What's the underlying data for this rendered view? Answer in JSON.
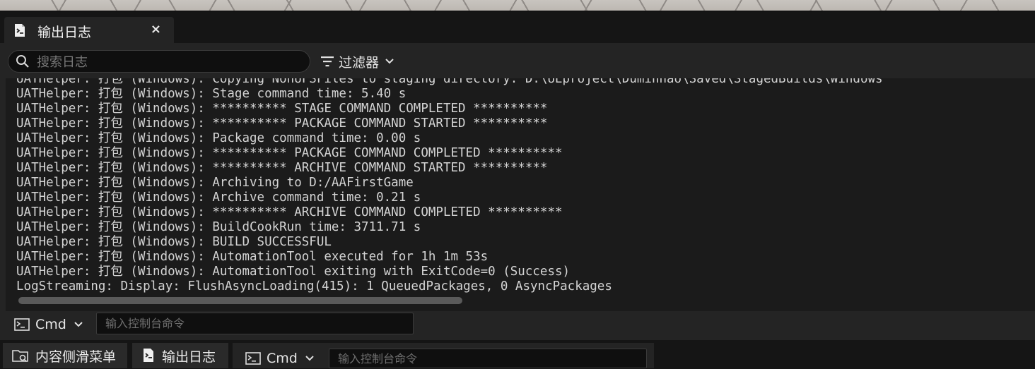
{
  "tab": {
    "title": "输出日志",
    "close": "×"
  },
  "toolbar": {
    "search_placeholder": "搜索日志",
    "filter_label": "过滤器"
  },
  "log": {
    "lines": [
      "UATHelper: 打包 (Windows): Copying NonUFSFiles to staging directory: D:\\UEproject\\Duminhao\\Saved\\StagedBuilds\\Windows",
      "UATHelper: 打包 (Windows): Stage command time: 5.40 s",
      "UATHelper: 打包 (Windows): ********** STAGE COMMAND COMPLETED **********",
      "UATHelper: 打包 (Windows): ********** PACKAGE COMMAND STARTED **********",
      "UATHelper: 打包 (Windows): Package command time: 0.00 s",
      "UATHelper: 打包 (Windows): ********** PACKAGE COMMAND COMPLETED **********",
      "UATHelper: 打包 (Windows): ********** ARCHIVE COMMAND STARTED **********",
      "UATHelper: 打包 (Windows): Archiving to D:/AAFirstGame",
      "UATHelper: 打包 (Windows): Archive command time: 0.21 s",
      "UATHelper: 打包 (Windows): ********** ARCHIVE COMMAND COMPLETED **********",
      "UATHelper: 打包 (Windows): BuildCookRun time: 3711.71 s",
      "UATHelper: 打包 (Windows): BUILD SUCCESSFUL",
      "UATHelper: 打包 (Windows): AutomationTool executed for 1h 1m 53s",
      "UATHelper: 打包 (Windows): AutomationTool exiting with ExitCode=0 (Success)",
      "LogStreaming: Display: FlushAsyncLoading(415): 1 QueuedPackages, 0 AsyncPackages"
    ]
  },
  "console": {
    "cmd_label": "Cmd",
    "input_placeholder": "输入控制台命令"
  },
  "drawer": {
    "content_drawer_label": "内容侧滑菜单",
    "output_log_label": "输出日志",
    "cmd_label": "Cmd",
    "input_placeholder": "输入控制台命令"
  }
}
